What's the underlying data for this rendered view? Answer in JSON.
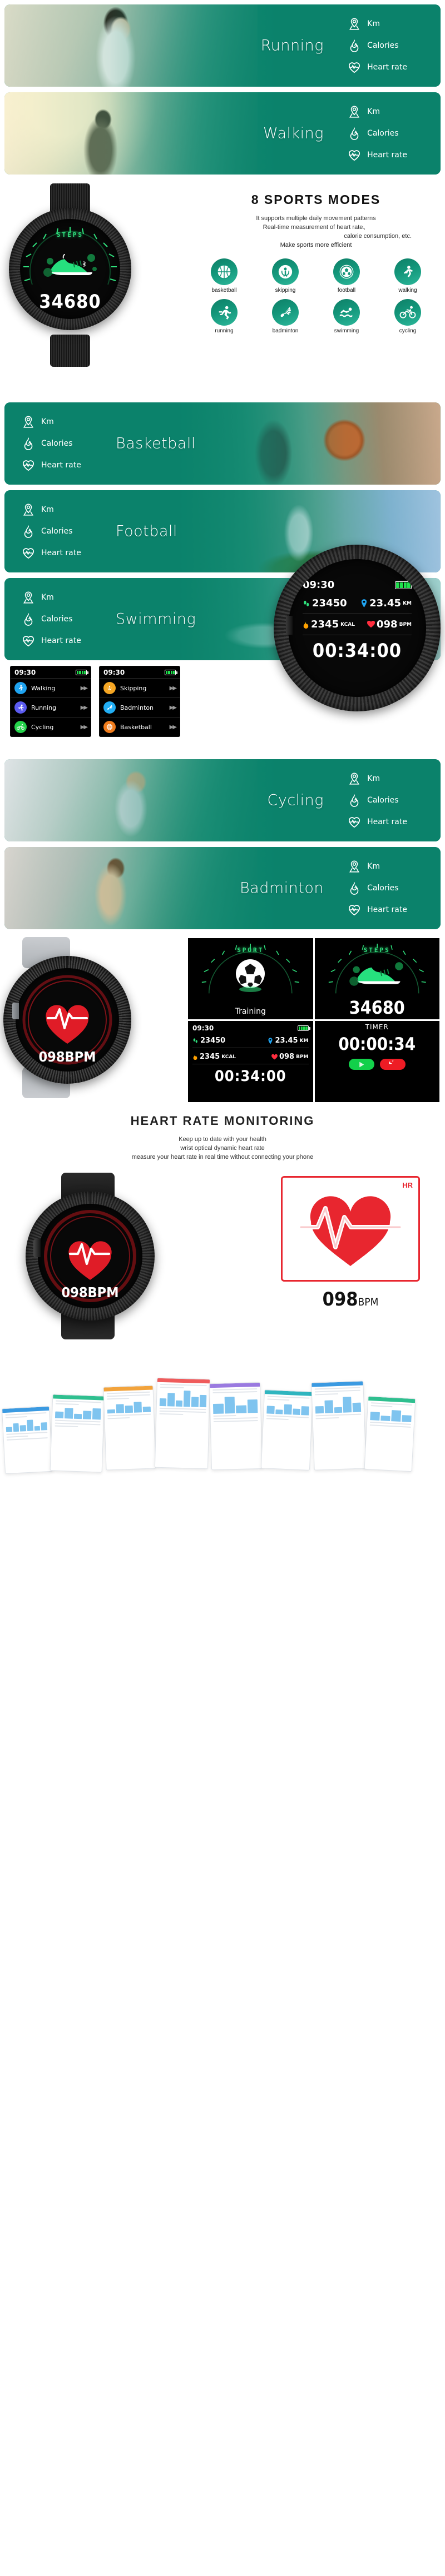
{
  "banners": [
    {
      "name": "Running",
      "metrics": [
        "Km",
        "Calories",
        "Heart rate"
      ],
      "photo_side": "left"
    },
    {
      "name": "Walking",
      "metrics": [
        "Km",
        "Calories",
        "Heart rate"
      ],
      "photo_side": "left"
    },
    {
      "name": "Basketball",
      "metrics": [
        "Km",
        "Calories",
        "Heart rate"
      ],
      "photo_side": "right"
    },
    {
      "name": "Football",
      "metrics": [
        "Km",
        "Calories",
        "Heart rate"
      ],
      "photo_side": "right"
    },
    {
      "name": "Swimming",
      "metrics": [
        "Km",
        "Calories",
        "Heart rate"
      ],
      "photo_side": "right"
    },
    {
      "name": "Cycling",
      "metrics": [
        "Km",
        "Calories",
        "Heart rate"
      ],
      "photo_side": "left"
    },
    {
      "name": "Badminton",
      "metrics": [
        "Km",
        "Calories",
        "Heart rate"
      ],
      "photo_side": "left"
    }
  ],
  "sports_section": {
    "title": "8  SPORTS  MODES",
    "lines": [
      "It supports multiple daily movement patterns",
      "Real-time measurement of heart rate、",
      "calorie consumption, etc.",
      "Make sports more efficient"
    ],
    "icons": [
      {
        "label": "basketball",
        "icon": "basketball-icon"
      },
      {
        "label": "skipping",
        "icon": "skipping-rope-icon"
      },
      {
        "label": "football",
        "icon": "football-icon"
      },
      {
        "label": "walking",
        "icon": "walking-icon"
      },
      {
        "label": "running",
        "icon": "running-icon"
      },
      {
        "label": "badminton",
        "icon": "badminton-icon"
      },
      {
        "label": "swimming",
        "icon": "swimming-icon"
      },
      {
        "label": "cycling",
        "icon": "cycling-icon"
      }
    ]
  },
  "watch_hero": {
    "dial_label": "STEPS",
    "steps": "34680"
  },
  "swim_watch": {
    "time": "09:30",
    "steps": "23450",
    "distance": "23.45",
    "distance_unit": "KM",
    "calories": "2345",
    "calories_unit": "KCAL",
    "heart_rate": "098",
    "heart_rate_unit": "BPM",
    "timer": "00:34:00"
  },
  "app_screens": [
    {
      "time": "09:30",
      "rows": [
        {
          "label": "Walking",
          "icon": "walking-icon",
          "color": "#1fa3f0"
        },
        {
          "label": "Running",
          "icon": "running-icon",
          "color": "#5b5bf0"
        },
        {
          "label": "Cycling",
          "icon": "cycling-icon",
          "color": "#24d24a"
        }
      ]
    },
    {
      "time": "09:30",
      "rows": [
        {
          "label": "Skipping",
          "icon": "skipping-rope-icon",
          "color": "#f5a623"
        },
        {
          "label": "Badminton",
          "icon": "badminton-icon",
          "color": "#22aef4"
        },
        {
          "label": "Basketball",
          "icon": "basketball-icon",
          "color": "#f07c1c"
        }
      ]
    }
  ],
  "face_grid": [
    {
      "type": "sport",
      "dial_label": "SPORT",
      "caption": "Training"
    },
    {
      "type": "steps",
      "dial_label": "STEPS",
      "value": "34680"
    },
    {
      "type": "dashboard",
      "time": "09:30",
      "steps": "23450",
      "distance": "23.45",
      "distance_unit": "KM",
      "calories": "2345",
      "calories_unit": "KCAL",
      "heart_rate": "098",
      "heart_rate_unit": "BPM",
      "timer": "00:34:00"
    },
    {
      "type": "timer",
      "title": "TIMER",
      "value": "00:00:34",
      "play_label": "play-button",
      "reset_label": "reset-button"
    }
  ],
  "heart_rate_section": {
    "title": "HEART  RATE  MONITORING",
    "lines": [
      "Keep up to date with your health",
      "wrist optical dynamic heart rate",
      "measure your heart rate in real time without connecting your phone"
    ],
    "watch_bpm": "098BPM",
    "panel_tag": "HR",
    "panel_bpm": "098",
    "panel_unit": "BPM"
  },
  "colors": {
    "brand_green": "#0d8a72",
    "accent_green": "#2cb79a",
    "heart_red": "#e8262f",
    "screen_green": "#32e07f"
  }
}
